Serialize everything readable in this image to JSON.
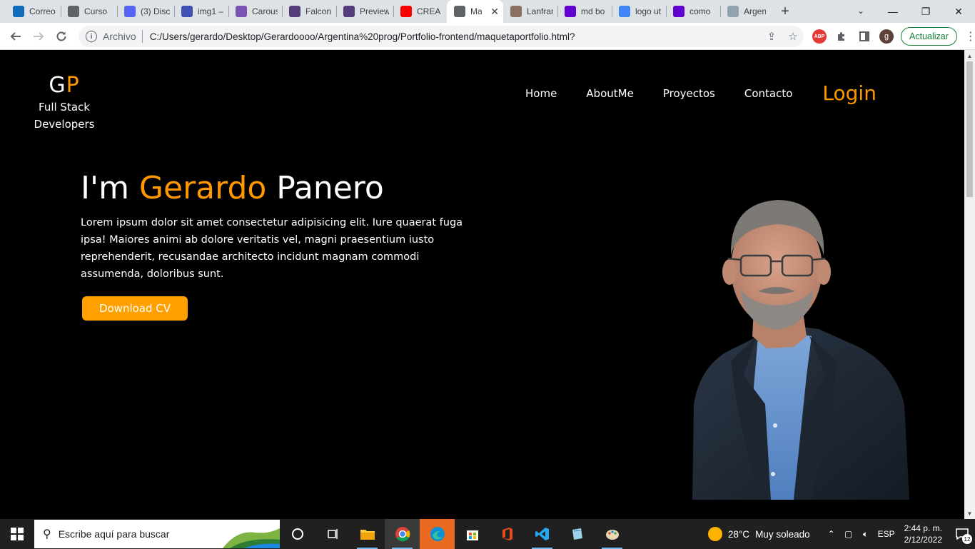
{
  "browser": {
    "tabs": [
      {
        "title": "Correo",
        "icon": "outlook-icon",
        "color": "#0f6cbd"
      },
      {
        "title": "Curso",
        "icon": "terminal-icon",
        "color": "#5f6368"
      },
      {
        "title": "(3) Disc",
        "icon": "discord-icon",
        "color": "#5865f2"
      },
      {
        "title": "img1 –",
        "icon": "image-icon",
        "color": "#3f51b5"
      },
      {
        "title": "Carous",
        "icon": "bootstrap-icon",
        "color": "#7952b3"
      },
      {
        "title": "Falcon",
        "icon": "bootstrap-icon",
        "color": "#563d7c"
      },
      {
        "title": "Preview",
        "icon": "bootstrap-icon",
        "color": "#563d7c"
      },
      {
        "title": "CREA T",
        "icon": "youtube-icon",
        "color": "#ff0000"
      },
      {
        "title": "Ma",
        "icon": "globe-icon",
        "color": "#5f6368",
        "active": true
      },
      {
        "title": "Lanfrar",
        "icon": "bird-icon",
        "color": "#8d6e63"
      },
      {
        "title": "md bo",
        "icon": "yahoo-icon",
        "color": "#6001d2"
      },
      {
        "title": "logo ut",
        "icon": "google-icon",
        "color": "#4285f4"
      },
      {
        "title": "como",
        "icon": "yahoo-icon",
        "color": "#6001d2"
      },
      {
        "title": "Argent",
        "icon": "emblem-icon",
        "color": "#90a4ae"
      }
    ],
    "close_tab": "✕",
    "new_tab": "+",
    "window": {
      "minimize": "—",
      "restore": "❐",
      "close": "✕"
    },
    "toolbar": {
      "scheme_label": "Archivo",
      "url": "C:/Users/gerardo/Desktop/Gerardoooo/Argentina%20prog/Portfolio-frontend/maquetaportfolio.html?",
      "update_label": "Actualizar",
      "profile_initial": "g",
      "abp_label": "ABP"
    }
  },
  "page": {
    "logo": {
      "g": "G",
      "p": "P",
      "tagline_1": "Full Stack",
      "tagline_2": "Developers"
    },
    "nav": {
      "home": "Home",
      "about": "AboutMe",
      "projects": "Proyectos",
      "contact": "Contacto",
      "login": "Login"
    },
    "hero": {
      "prefix": "I'm ",
      "first_name": "Gerardo",
      "last_name": " Panero",
      "text": "Lorem ipsum dolor sit amet consectetur adipisicing elit. Iure quaerat fuga ipsa! Maiores animi ab dolore veritatis vel, magni praesentium iusto reprehenderit, recusandae architecto incidunt magnam commodi assumenda, doloribus sunt.",
      "button": "Download CV"
    },
    "accent_color": "#ff9800"
  },
  "taskbar": {
    "search_placeholder": "Escribe aquí para buscar",
    "weather": {
      "temp": "28°C",
      "desc": "Muy soleado"
    },
    "lang": "ESP",
    "time": "2:44 p. m.",
    "date": "2/12/2022",
    "notifications": "12"
  }
}
